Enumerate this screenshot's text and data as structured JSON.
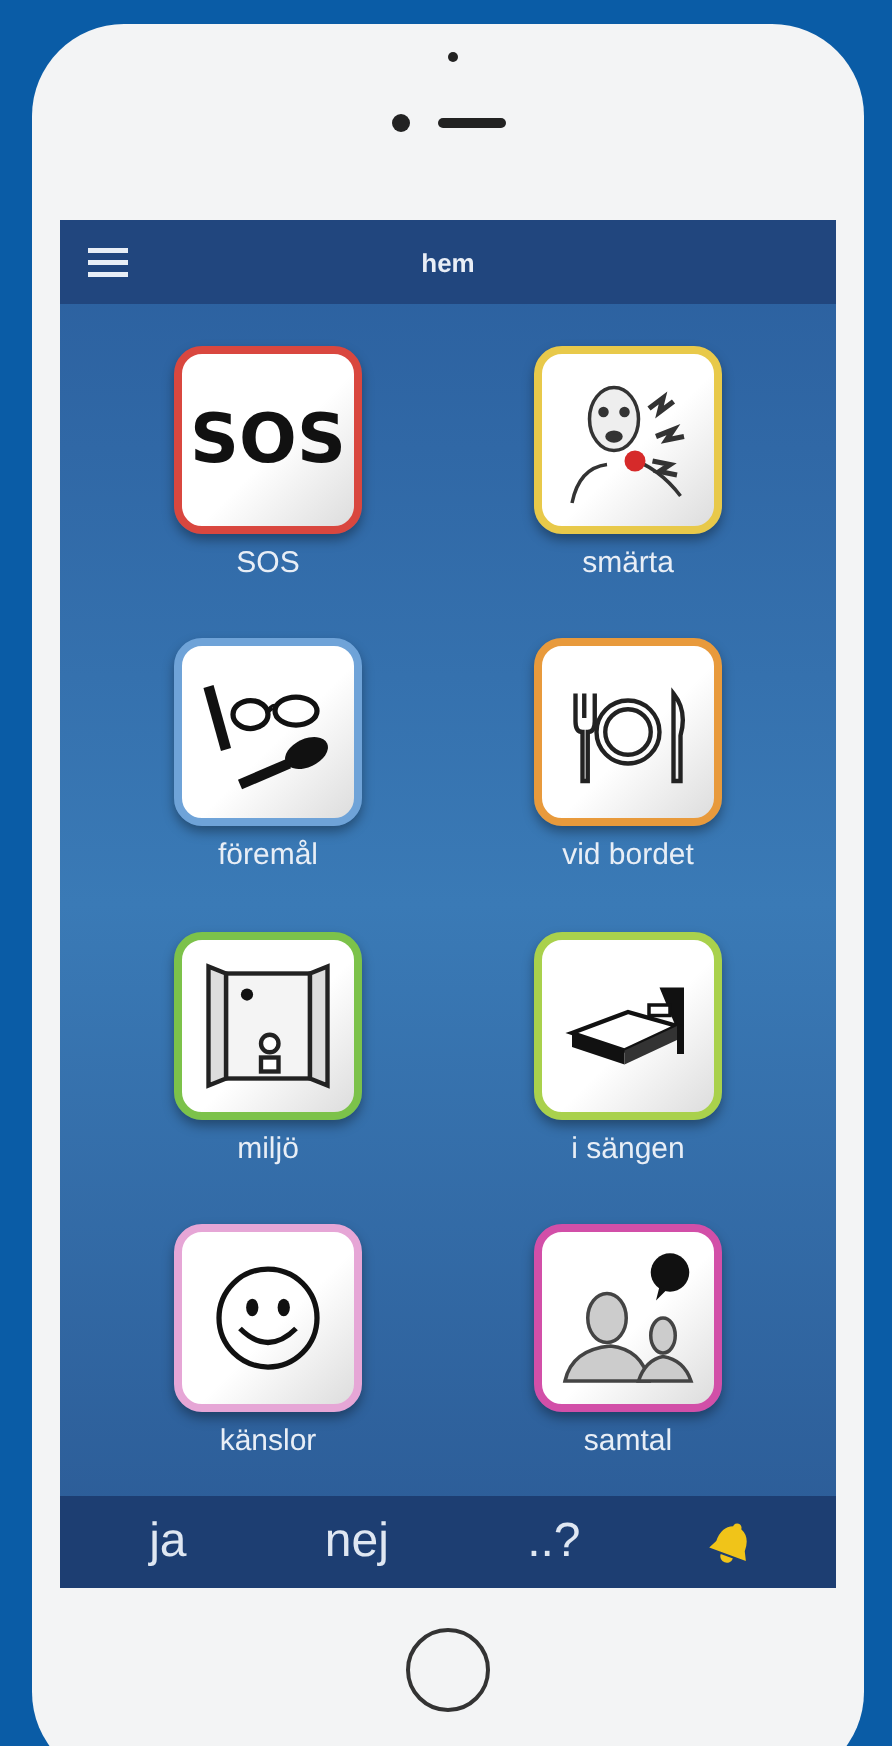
{
  "header": {
    "title": "hem"
  },
  "tiles": [
    {
      "label": "SOS",
      "kind": "sos",
      "symbol": "SOS",
      "color": "#d9473f"
    },
    {
      "label": "smärta",
      "kind": "pain",
      "color": "#e8c94a"
    },
    {
      "label": "föremål",
      "kind": "objects",
      "color": "#6fa3d8"
    },
    {
      "label": "vid bordet",
      "kind": "table",
      "color": "#e89a3c"
    },
    {
      "label": "miljö",
      "kind": "room",
      "color": "#7cc24a"
    },
    {
      "label": "i sängen",
      "kind": "bed",
      "color": "#a9d14c"
    },
    {
      "label": "känslor",
      "kind": "face",
      "color": "#e6a6d6"
    },
    {
      "label": "samtal",
      "kind": "talk",
      "color": "#d24fa8"
    }
  ],
  "bottom_bar": {
    "buttons": [
      "ja",
      "nej",
      "..?"
    ]
  }
}
